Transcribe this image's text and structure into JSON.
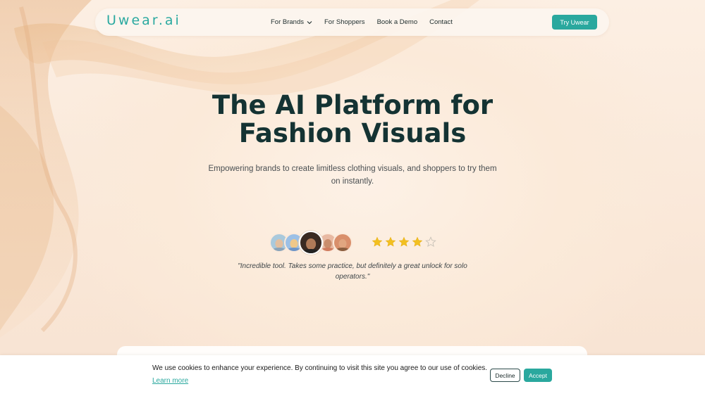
{
  "brand": {
    "logo_text": "Uwear.ai",
    "accent_color": "#2aa89e"
  },
  "nav": {
    "items": [
      {
        "label": "For Brands",
        "has_dropdown": true
      },
      {
        "label": "For Shoppers"
      },
      {
        "label": "Book a Demo"
      },
      {
        "label": "Contact"
      }
    ],
    "cta_label": "Try Uwear"
  },
  "hero": {
    "title_line1": "The AI Platform for",
    "title_line2": "Fashion Visuals",
    "subtitle": "Empowering brands to create limitless clothing visuals, and shoppers to try them on instantly."
  },
  "testimonial": {
    "rating": 4,
    "rating_max": 5,
    "quote": "\"Incredible tool. Takes some practice, but definitely a great unlock for solo operators.\"",
    "avatars": [
      "avatar",
      "avatar",
      "avatar",
      "avatar",
      "avatar"
    ]
  },
  "cookie_banner": {
    "message": "We use cookies to enhance your experience. By continuing to visit this site you agree to our use of cookies.",
    "learn_more": "Learn more",
    "decline_label": "Decline",
    "accept_label": "Accept"
  }
}
